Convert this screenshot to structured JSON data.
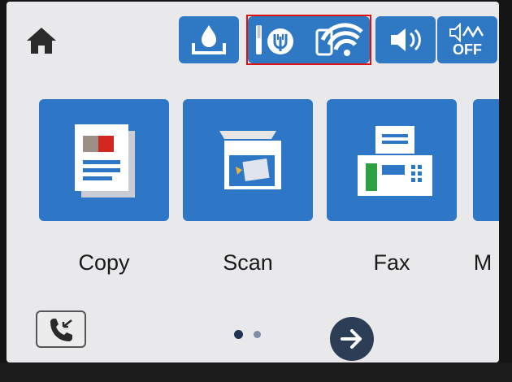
{
  "status_bar": {
    "home_icon": "home-icon",
    "ink_icon": "ink-icon",
    "wifi_direct_icon": "wifi-direct-icon",
    "wifi_icon": "wifi-icon",
    "volume_icon": "volume-icon",
    "quiet_mode_icon": "quiet-mode-icon",
    "quiet_mode_label": "OFF"
  },
  "apps": [
    {
      "label": "Copy",
      "icon": "copy-icon"
    },
    {
      "label": "Scan",
      "icon": "scan-icon"
    },
    {
      "label": "Fax",
      "icon": "fax-icon"
    },
    {
      "label": "M",
      "icon": "more-icon"
    }
  ],
  "bottom_bar": {
    "fax_log_icon": "fax-incoming-icon",
    "page_count": 2,
    "current_page": 1,
    "next_icon": "arrow-right-icon"
  },
  "colors": {
    "accent": "#2d77c6",
    "highlight": "#e01010",
    "next_button": "#2b3e56"
  }
}
